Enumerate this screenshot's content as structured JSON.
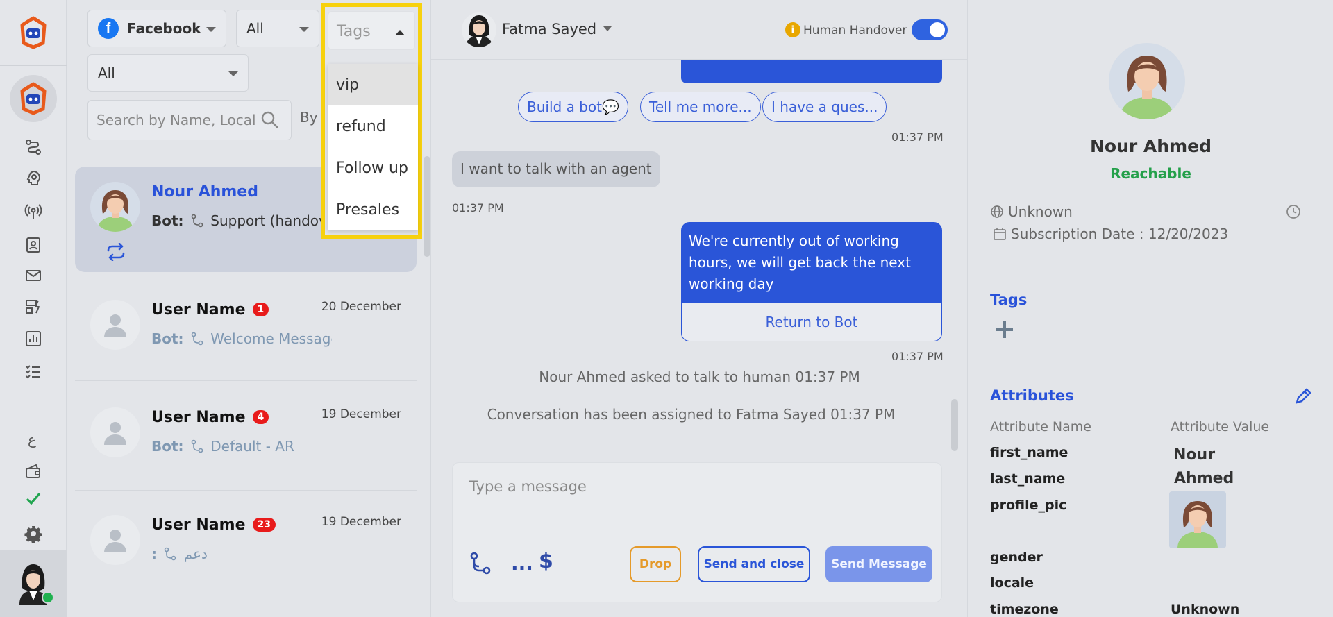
{
  "filters": {
    "channel": "Facebook",
    "status": "All",
    "assignment": "All",
    "search_placeholder": "Search by Name, Local ID",
    "by_label": "By"
  },
  "tags_dropdown": {
    "placeholder": "Tags",
    "options": [
      "vip",
      "refund",
      "Follow up",
      "Presales"
    ]
  },
  "conversations": [
    {
      "name": "Nour Ahmed",
      "bot_label": "Bot:",
      "flow": "Support (handover)",
      "date": "",
      "badge": ""
    },
    {
      "name": "User Name",
      "bot_label": "Bot:",
      "flow": "Welcome Message",
      "date": "20 December",
      "badge": "1"
    },
    {
      "name": "User Name",
      "bot_label": "Bot:",
      "flow": "Default - AR",
      "date": "19 December",
      "badge": "4"
    },
    {
      "name": "User Name",
      "bot_label": ":",
      "flow": "دعم",
      "date": "19 December",
      "badge": "23"
    }
  ],
  "chat": {
    "agent_name": "Fatma Sayed",
    "human_handover_label": "Human Handover",
    "human_handover_on": true,
    "quick_replies": [
      "Build a bot💬",
      "Tell me more...",
      "I have a ques..."
    ],
    "time_1": "01:37 PM",
    "incoming_message": "I want to talk with an agent",
    "time_2": "01:37 PM",
    "outgoing_message": "We're currently out of working hours, we will get back the next working day",
    "return_to_bot_label": "Return to Bot",
    "time_3": "01:37 PM",
    "system_1": "Nour Ahmed asked to talk to human 01:37 PM",
    "system_2": "Conversation has been assigned to Fatma Sayed 01:37 PM",
    "composer_placeholder": "Type a message",
    "dots": "...",
    "dollar": "$",
    "drop_label": "Drop",
    "send_close_label": "Send and close",
    "send_label": "Send Message"
  },
  "profile": {
    "name": "Nour Ahmed",
    "status": "Reachable",
    "location": "Unknown",
    "subscription": "Subscription Date : 12/20/2023",
    "tags_title": "Tags",
    "attributes_title": "Attributes",
    "attr_name_header": "Attribute Name",
    "attr_value_header": "Attribute Value",
    "attr_first_name_key": "first_name",
    "attr_last_name_key": "last_name",
    "attr_profile_pic_key": "profile_pic",
    "attr_gender_key": "gender",
    "attr_locale_key": "locale",
    "attr_timezone_key": "timezone",
    "attr_first_name_val": "Nour",
    "attr_last_name_val": "Ahmed",
    "attr_timezone_val": "Unknown"
  },
  "colors": {
    "accent_blue": "#2a55d8",
    "tags_highlight": "#f7d10e",
    "reachable_green": "#24a04a",
    "badge_red": "#e81b1b",
    "drop_orange": "#e59a2a"
  }
}
